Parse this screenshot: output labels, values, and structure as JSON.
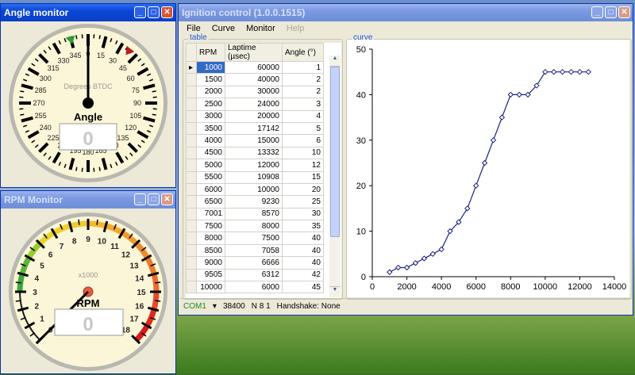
{
  "angle_window": {
    "title": "Angle monitor",
    "gauge_label": "Degrees BTDC",
    "name": "Angle",
    "value": "0",
    "ticks": [
      "0",
      "15",
      "30",
      "45",
      "60",
      "75",
      "90",
      "105",
      "120",
      "135",
      "150",
      "165",
      "180",
      "195",
      "210",
      "225",
      "240",
      "255",
      "270",
      "285",
      "300",
      "315",
      "330",
      "345"
    ],
    "needle_deg": 0,
    "marker_green_deg": 345,
    "marker_red_deg": 38
  },
  "rpm_window": {
    "title": "RPM Monitor",
    "unit": "x1000",
    "name": "RPM",
    "value": "0",
    "ticks": [
      "0",
      "1",
      "2",
      "3",
      "4",
      "5",
      "6",
      "7",
      "8",
      "9",
      "10",
      "11",
      "12",
      "13",
      "14",
      "15",
      "16",
      "17",
      "18"
    ],
    "needle_value": 0
  },
  "main_window": {
    "title": "Ignition control (1.0.0.1515)",
    "menu": [
      "File",
      "Curve",
      "Monitor",
      "Help"
    ],
    "table_group": "table",
    "curve_group": "curve",
    "columns": [
      "RPM",
      "Laptime (µsec)",
      "Angle (°)"
    ],
    "rows": [
      [
        "1000",
        "60000",
        "1"
      ],
      [
        "1500",
        "40000",
        "2"
      ],
      [
        "2000",
        "30000",
        "2"
      ],
      [
        "2500",
        "24000",
        "3"
      ],
      [
        "3000",
        "20000",
        "4"
      ],
      [
        "3500",
        "17142",
        "5"
      ],
      [
        "4000",
        "15000",
        "6"
      ],
      [
        "4500",
        "13332",
        "10"
      ],
      [
        "5000",
        "12000",
        "12"
      ],
      [
        "5500",
        "10908",
        "15"
      ],
      [
        "6000",
        "10000",
        "20"
      ],
      [
        "6500",
        "9230",
        "25"
      ],
      [
        "7001",
        "8570",
        "30"
      ],
      [
        "7500",
        "8000",
        "35"
      ],
      [
        "8000",
        "7500",
        "40"
      ],
      [
        "8500",
        "7058",
        "40"
      ],
      [
        "9000",
        "6666",
        "40"
      ],
      [
        "9505",
        "6312",
        "42"
      ],
      [
        "10000",
        "6000",
        "45"
      ]
    ],
    "status": {
      "port": "COM1",
      "baud": "38400",
      "format": "N 8 1",
      "handshake": "Handshake: None"
    }
  },
  "chart_data": {
    "type": "line",
    "x": [
      1000,
      1500,
      2000,
      2500,
      3000,
      3500,
      4000,
      4500,
      5000,
      5500,
      6000,
      6500,
      7001,
      7500,
      8000,
      8500,
      9000,
      9505,
      10000,
      10500,
      11000,
      11500,
      12000,
      12500
    ],
    "y": [
      1,
      2,
      2,
      3,
      4,
      5,
      6,
      10,
      12,
      15,
      20,
      25,
      30,
      35,
      40,
      40,
      40,
      42,
      45,
      45,
      45,
      45,
      45,
      45
    ],
    "xlim": [
      0,
      14000
    ],
    "ylim": [
      0,
      50
    ],
    "xticks": [
      "0",
      "2000",
      "4000",
      "6000",
      "8000",
      "10000",
      "12000",
      "14000"
    ],
    "yticks": [
      "0",
      "10",
      "20",
      "30",
      "40",
      "50"
    ],
    "line_color": "#1a237e",
    "grid": false
  }
}
